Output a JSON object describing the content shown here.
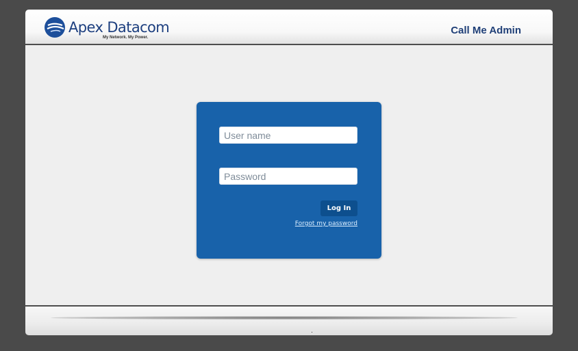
{
  "header": {
    "brand_name": "Apex Datacom",
    "brand_tagline": "My Network. My Power.",
    "title": "Call Me Admin"
  },
  "login": {
    "username_placeholder": "User name",
    "password_placeholder": "Password",
    "button_label": "Log In",
    "forgot_label": "Forgot my password"
  },
  "colors": {
    "brand_blue": "#1d3f7f",
    "panel_blue": "#1862aa",
    "button_blue": "#0d4f8e"
  },
  "icons": {
    "logo": "apex-datacom-logo-icon"
  }
}
